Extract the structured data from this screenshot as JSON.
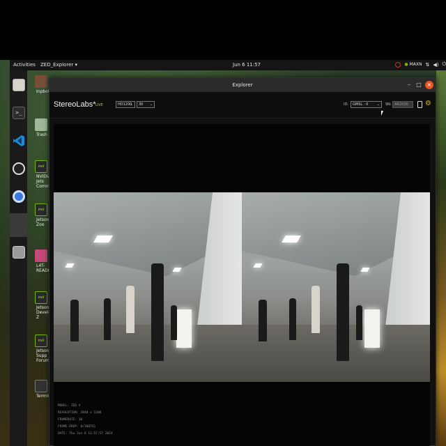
{
  "topbar": {
    "activities": "Activities",
    "app_menu": "ZED_Explorer ▾",
    "clock": "Jun 6 11:57",
    "power_mode": "MAXN"
  },
  "dock": {
    "items": [
      {
        "name": "files"
      },
      {
        "name": "terminal"
      },
      {
        "name": "vscode"
      },
      {
        "name": "obs"
      },
      {
        "name": "chromium"
      },
      {
        "name": "zed-explorer"
      },
      {
        "name": "disks"
      }
    ]
  },
  "desktop": {
    "icons": [
      {
        "label": "Inpbot"
      },
      {
        "label": "Trash"
      },
      {
        "label": "NVIDIA Jets\nCommunity"
      },
      {
        "label": "Jetson Zoo"
      },
      {
        "label": "L4T-READM"
      },
      {
        "label": "Jetson\nDeveloper Z"
      },
      {
        "label": "Jetson Supp\nForums"
      },
      {
        "label": "Terminal"
      }
    ]
  },
  "window": {
    "title": "Explorer",
    "brand": "StereoLabs*",
    "live_badge": "LIVE",
    "resolution_value": "HD1200",
    "fps_value": "30",
    "id_label": "ID:",
    "id_value": "GMSL - 0",
    "sn_label": "SN:",
    "sn_value": "AR2036"
  },
  "info": {
    "model": "MODEL: ZED X",
    "resolution": "RESOLUTION: 3840 x 1200",
    "framerate": "FRAMERATE: 30",
    "frame_drop": "FRAME DROP: 0/108741",
    "date": "DATE: Thu Jun 6 11:57:57 2024"
  },
  "colors": {
    "accent_close": "#e95420",
    "live_green": "#9ccc4a",
    "gear_yellow": "#d4b22a",
    "nvidia_green": "#76b900"
  }
}
